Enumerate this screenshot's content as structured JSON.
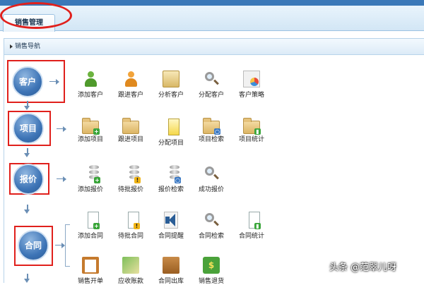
{
  "tab": {
    "label": "销售管理"
  },
  "panel": {
    "title": "销售导航"
  },
  "nodes": [
    {
      "label": "客户"
    },
    {
      "label": "项目"
    },
    {
      "label": "报价"
    },
    {
      "label": "合同"
    }
  ],
  "customer_items": [
    {
      "label": "添加客户",
      "icon": "add-customer-icon"
    },
    {
      "label": "跟进客户",
      "icon": "follow-customer-icon"
    },
    {
      "label": "分析客户",
      "icon": "analyze-customer-icon"
    },
    {
      "label": "分配客户",
      "icon": "assign-customer-icon"
    },
    {
      "label": "客户策略",
      "icon": "customer-strategy-icon"
    }
  ],
  "project_items": [
    {
      "label": "添加项目",
      "icon": "add-project-icon"
    },
    {
      "label": "跟进项目",
      "icon": "follow-project-icon"
    },
    {
      "label": "分配项目",
      "icon": "assign-project-icon"
    },
    {
      "label": "项目检索",
      "icon": "search-project-icon"
    },
    {
      "label": "项目统计",
      "icon": "project-stats-icon"
    }
  ],
  "quote_items": [
    {
      "label": "添加报价",
      "icon": "add-quote-icon"
    },
    {
      "label": "待批报价",
      "icon": "pending-quote-icon"
    },
    {
      "label": "报价检索",
      "icon": "search-quote-icon"
    },
    {
      "label": "成功报价",
      "icon": "successful-quote-icon"
    }
  ],
  "contract_items": [
    {
      "label": "添加合同",
      "icon": "add-contract-icon"
    },
    {
      "label": "待批合同",
      "icon": "pending-contract-icon"
    },
    {
      "label": "合同提醒",
      "icon": "contract-reminder-icon"
    },
    {
      "label": "合同检索",
      "icon": "search-contract-icon"
    },
    {
      "label": "合同统计",
      "icon": "contract-stats-icon"
    }
  ],
  "contract_items_2": [
    {
      "label": "销售开单",
      "icon": "sales-order-icon"
    },
    {
      "label": "应收账款",
      "icon": "receivables-icon"
    },
    {
      "label": "合同出库",
      "icon": "contract-outbound-icon"
    },
    {
      "label": "销售退货",
      "icon": "sales-return-icon"
    }
  ],
  "watermark": "头条 @范翠儿呀",
  "colors": {
    "accent": "#3d74b6",
    "highlight": "#e0201c"
  }
}
